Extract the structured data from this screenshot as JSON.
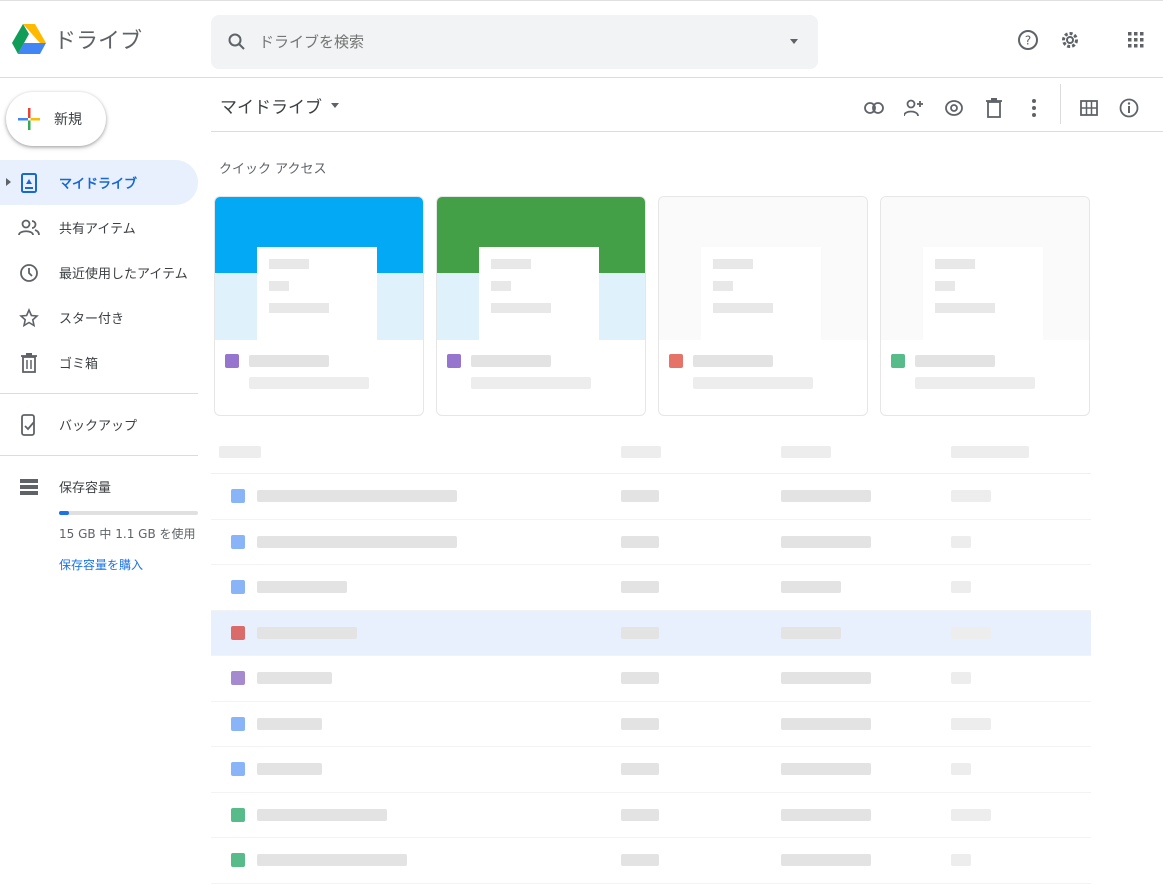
{
  "app": {
    "name": "ドライブ"
  },
  "search": {
    "placeholder": "ドライブを検索"
  },
  "new_button": {
    "label": "新規"
  },
  "nav": [
    {
      "label": "マイドライブ",
      "icon": "drive-icon",
      "active": true
    },
    {
      "label": "共有アイテム",
      "icon": "people-icon",
      "active": false
    },
    {
      "label": "最近使用したアイテム",
      "icon": "clock-icon",
      "active": false
    },
    {
      "label": "スター付き",
      "icon": "star-icon",
      "active": false
    },
    {
      "label": "ゴミ箱",
      "icon": "trash-icon",
      "active": false
    }
  ],
  "backup": {
    "label": "バックアップ"
  },
  "storage": {
    "label": "保存容量",
    "usage_text": "15 GB 中 1.1 GB を使用",
    "used_fraction": 0.073,
    "buy_link": "保存容量を購入"
  },
  "main": {
    "breadcrumb": "マイドライブ",
    "quick_access_title": "クイック アクセス"
  },
  "colors": {
    "accent": "#1a73e8",
    "active_bg": "#e8f0fe"
  },
  "quick_access_cards": [
    {
      "thumb_color": "#03a9f4",
      "type_color": "#9575cd"
    },
    {
      "thumb_color": "#43a047",
      "type_color": "#9575cd"
    },
    {
      "thumb_color": "#ffffff",
      "type_color": "#e57368"
    },
    {
      "thumb_color": "#ffffff",
      "type_color": "#57bb8a"
    }
  ],
  "file_rows": [
    {
      "type_color": "#8ab4f8",
      "selected": false
    },
    {
      "type_color": "#8ab4f8",
      "selected": false
    },
    {
      "type_color": "#8ab4f8",
      "selected": false
    },
    {
      "type_color": "#db6b6b",
      "selected": true
    },
    {
      "type_color": "#a58ad0",
      "selected": false
    },
    {
      "type_color": "#8ab4f8",
      "selected": false
    },
    {
      "type_color": "#8ab4f8",
      "selected": false
    },
    {
      "type_color": "#57bb8a",
      "selected": false
    },
    {
      "type_color": "#57bb8a",
      "selected": false
    }
  ]
}
